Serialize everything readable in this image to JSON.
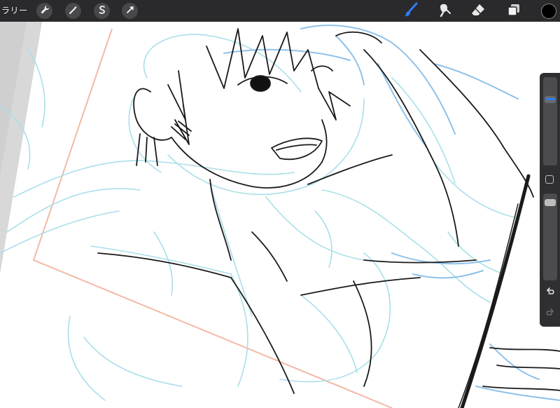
{
  "topbar": {
    "gallery_label": "ラリー",
    "left_tools": [
      {
        "name": "wrench-icon"
      },
      {
        "name": "magic-wand-icon"
      },
      {
        "name": "selection-icon"
      },
      {
        "name": "transform-arrow-icon"
      }
    ],
    "right_tools": [
      {
        "name": "brush-icon",
        "active": true
      },
      {
        "name": "smudge-icon",
        "active": false
      },
      {
        "name": "eraser-icon",
        "active": false
      },
      {
        "name": "layers-icon",
        "active": false
      }
    ],
    "current_color": "#000000",
    "accent_color": "#2f7cf6"
  },
  "sidebar": {
    "brush_size_level": 0.22,
    "opacity_level": 0.05,
    "undo_icon": "undo-icon",
    "redo_icon": "redo-icon"
  },
  "canvas": {
    "guide_color": "#a9dfe9",
    "sketch_color": "#8ec1ea",
    "frame_color": "#f3b9a6",
    "ink_color": "#1a1a1a"
  }
}
